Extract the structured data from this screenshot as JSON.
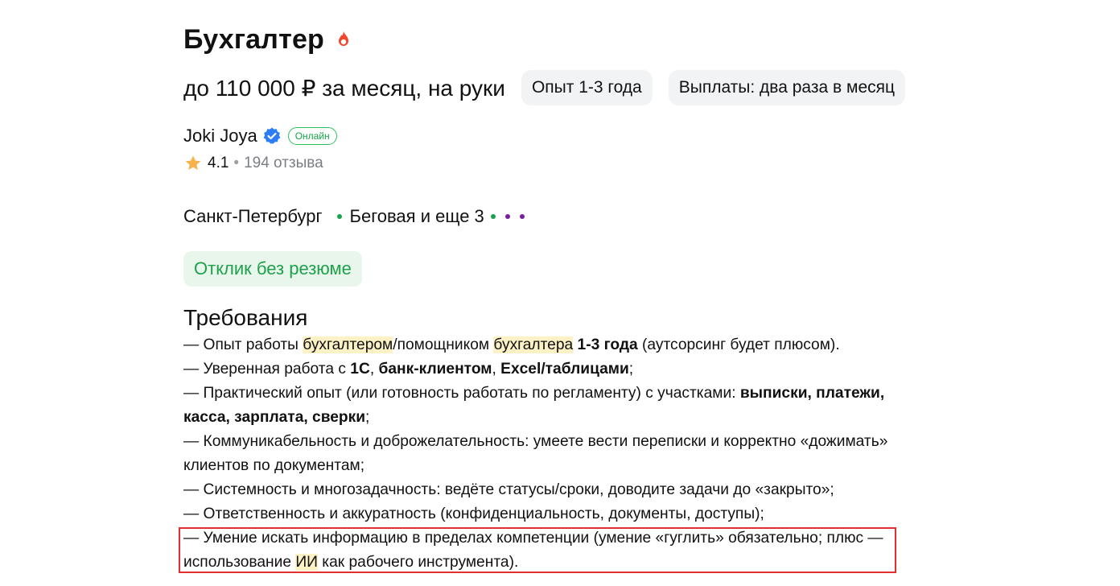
{
  "vacancy": {
    "title": "Бухгалтер",
    "salary": "до 110 000 ₽ за месяц, на руки",
    "chips": [
      "Опыт 1-3 года",
      "Выплаты: два раза в месяц"
    ]
  },
  "employer": {
    "name": "Joki Joya",
    "status_badge": "Онлайн",
    "rating": "4.1",
    "separator": "•",
    "reviews": "194 отзыва"
  },
  "location": {
    "city": "Санкт-Петербург",
    "metro": "Беговая и еще 3"
  },
  "apply_button": "Отклик без резюме",
  "requirements": {
    "title": "Требования",
    "items": [
      [
        {
          "t": "— Опыт работы "
        },
        {
          "t": "бухгалтером",
          "hl": true
        },
        {
          "t": "/помощником "
        },
        {
          "t": "бухгалтера",
          "hl": true
        },
        {
          "t": " "
        },
        {
          "t": "1-3 года",
          "b": true
        },
        {
          "t": " (аутсорсинг будет плюсом)."
        }
      ],
      [
        {
          "t": "— Уверенная работа с "
        },
        {
          "t": "1С",
          "b": true
        },
        {
          "t": ", "
        },
        {
          "t": "банк-клиентом",
          "b": true
        },
        {
          "t": ", "
        },
        {
          "t": "Excel/таблицами",
          "b": true
        },
        {
          "t": ";"
        }
      ],
      [
        {
          "t": "— Практический опыт (или готовность работать по регламенту) с участками: "
        },
        {
          "t": "выписки, платежи, касса, зарплата, сверки",
          "b": true
        },
        {
          "t": ";"
        }
      ],
      [
        {
          "t": "— Коммуникабельность и доброжелательность: умеете вести переписки и корректно «дожимать» клиентов по документам;"
        }
      ],
      [
        {
          "t": "— Системность и многозадачность: ведёте статусы/сроки, доводите задачи до «закрыто»;"
        }
      ],
      [
        {
          "t": "— Ответственность и аккуратность (конфиденциальность, документы, доступы);"
        }
      ],
      [
        {
          "t": "— Умение искать информацию в пределах компетенции (умение «гуглить» обязательно; плюс — использование "
        },
        {
          "t": "ИИ",
          "hl": true
        },
        {
          "t": " как рабочего инструмента)."
        }
      ]
    ]
  },
  "colors": {
    "accent_green": "#1ea14b",
    "highlight": "#fdf1c6",
    "callout_border": "#e03030",
    "verified_blue": "#2d7df6",
    "hot_red": "#f2452c",
    "metro_green": "#16a34a",
    "metro_purple": "#7a1fa2"
  },
  "icons": [
    "fire-icon",
    "verified-check-icon",
    "star-icon",
    "metro-dot-icon"
  ]
}
